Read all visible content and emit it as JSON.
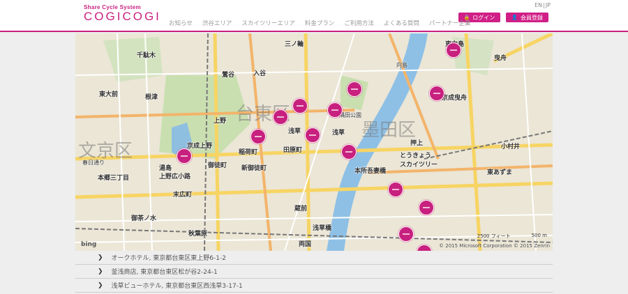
{
  "header": {
    "logo_small": "Share Cycle System",
    "logo_big": "COGICOGI",
    "lang": [
      "EN",
      "JP"
    ],
    "nav": [
      "お知らせ",
      "渋谷エリア",
      "スカイツリーエリア",
      "料金プラン",
      "ご利用方法",
      "よくある質問",
      "パートナー企業"
    ],
    "login": "ログイン",
    "register": "会員登録",
    "accent": "#c8207f"
  },
  "map": {
    "labels": {
      "bunkyo": "文京区",
      "taito": "台東区",
      "sumida": "墨田区",
      "ueno": "上野",
      "asakusa": "浅草",
      "asakusa2": "浅草",
      "inaricho": "稲荷町",
      "tawaramachi": "田原町",
      "oshiage": "押上",
      "skytree": "とうきょう\nスカイツリー",
      "honjo": "本所吾妻橋",
      "keiseiueno": "京成上野",
      "okachimachi": "御徒町",
      "shinokachimachi": "新御徒町",
      "uenohirokoji": "上野広小路",
      "akihabara": "秋葉原",
      "ryogoku": "両国",
      "kuramae": "蔵前",
      "hikifune": "曳舟",
      "keiseihikifune": "京成曳舟",
      "higashimukojima": "東向島",
      "ogi": "小村井",
      "higashiazuma": "東あずま",
      "iriya": "入谷",
      "uguisudani": "鶯谷",
      "nippori": "日暮里",
      "sendagi": "千駄木",
      "nezu": "根津",
      "todaimae": "東大前",
      "yushima": "湯島",
      "suehirocho": "末広町",
      "ochanomizu": "御茶ノ水",
      "hongo": "本郷三丁目",
      "kasuga": "春日通り",
      "minowa": "三ノ輪",
      "sumidapark": "隅田公園",
      "mukojima": "向島",
      "shinbashi": "浅草橋"
    },
    "bing": "bing",
    "attribution": "© 2015 Microsoft Corporation  © 2015 Zenrin",
    "scale_ft": "2500 フィート",
    "scale_m": "500 m"
  },
  "locations": [
    "オークホテル, 東京都台東区東上野6-1-2",
    "釜浅商店, 東京都台東区松が谷2-24-1",
    "浅草ビューホテル, 東京都台東区西浅草3-17-1"
  ]
}
